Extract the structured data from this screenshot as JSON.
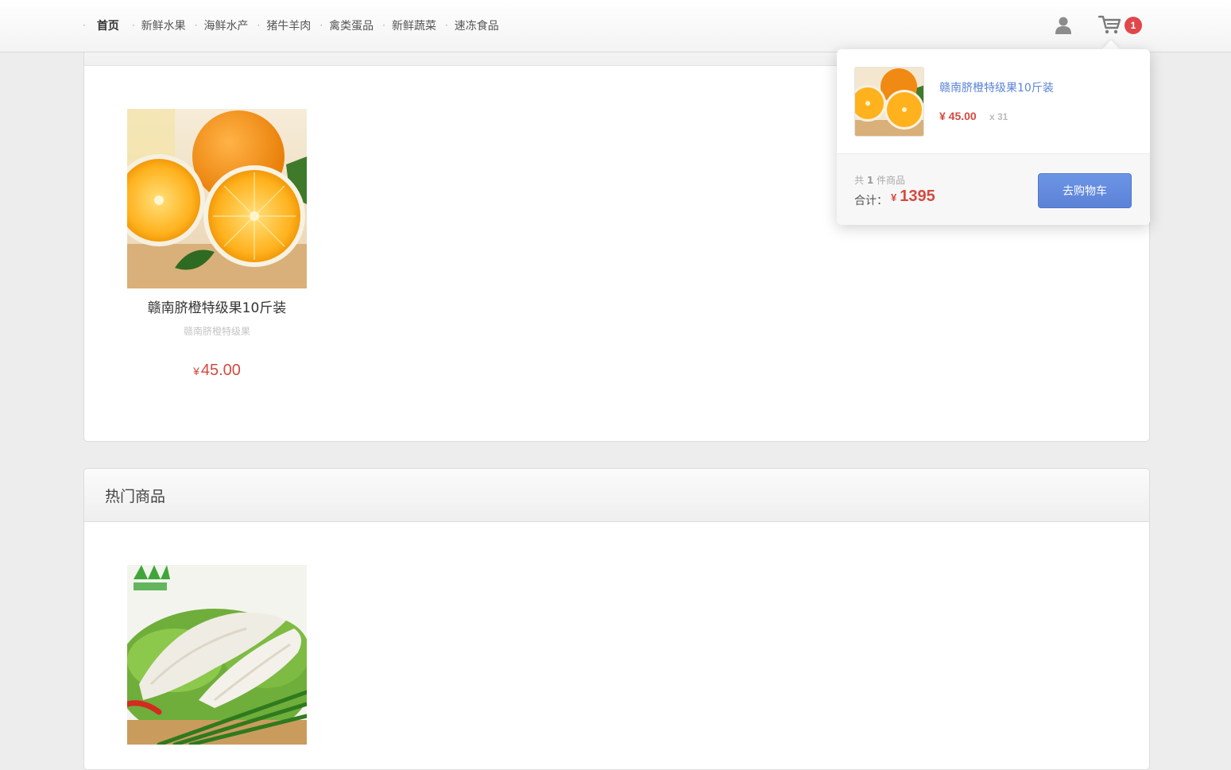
{
  "nav": {
    "items": [
      {
        "label": "首页",
        "active": true
      },
      {
        "label": "新鲜水果",
        "active": false
      },
      {
        "label": "海鲜水产",
        "active": false
      },
      {
        "label": "猪牛羊肉",
        "active": false
      },
      {
        "label": "禽类蛋品",
        "active": false
      },
      {
        "label": "新鲜蔬菜",
        "active": false
      },
      {
        "label": "速冻食品",
        "active": false
      }
    ],
    "user_icon": "user-icon",
    "cart_icon": "shopping-cart-icon",
    "cart_badge": "1"
  },
  "section1": {
    "product": {
      "image": "orange-photo",
      "name": "赣南脐橙特级果10斤装",
      "subtitle": "赣南脐橙特级果",
      "currency": "¥",
      "price": "45.00"
    }
  },
  "section2": {
    "title": "热门商品",
    "product": {
      "image": "pork-intestine-photo"
    }
  },
  "cart_dropdown": {
    "item": {
      "name": "赣南脐橙特级果10斤装",
      "price": "¥ 45.00",
      "qty": "x 31"
    },
    "count_prefix": "共",
    "count": "1",
    "count_suffix": "件商品",
    "total_label": "合计：",
    "currency": "¥",
    "total": "1395",
    "checkout_label": "去购物车"
  },
  "colors": {
    "accent_blue": "#5b82d6",
    "price_red": "#d44a3f",
    "badge_red": "#e0474c"
  }
}
